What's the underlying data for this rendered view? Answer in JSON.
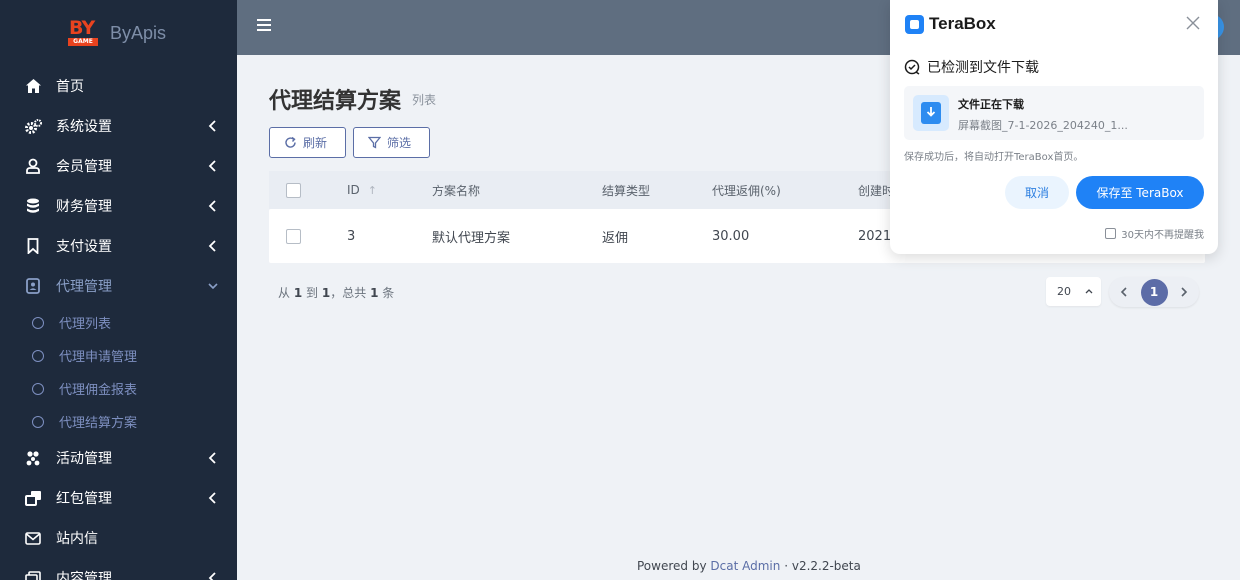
{
  "brand": {
    "logo_text": "BY",
    "logo_sub": "GAME",
    "name": "ByApis"
  },
  "sidebar": {
    "items": [
      {
        "label": "首页",
        "icon": "home-icon"
      },
      {
        "label": "系统设置",
        "icon": "cogs-icon"
      },
      {
        "label": "会员管理",
        "icon": "user-icon"
      },
      {
        "label": "财务管理",
        "icon": "database-icon"
      },
      {
        "label": "支付设置",
        "icon": "bookmark-icon"
      },
      {
        "label": "代理管理",
        "icon": "contact-icon"
      },
      {
        "label": "活动管理",
        "icon": "pinwheel-icon"
      },
      {
        "label": "红包管理",
        "icon": "clone-icon"
      },
      {
        "label": "站内信",
        "icon": "envelope-icon"
      },
      {
        "label": "内容管理",
        "icon": "window-icon"
      }
    ],
    "sub_items": [
      {
        "label": "代理列表"
      },
      {
        "label": "代理申请管理"
      },
      {
        "label": "代理佣金报表"
      },
      {
        "label": "代理结算方案"
      }
    ]
  },
  "page": {
    "title": "代理结算方案",
    "subtitle": "列表"
  },
  "toolbar": {
    "refresh_label": "刷新",
    "filter_label": "筛选"
  },
  "table": {
    "headers": [
      "ID",
      "方案名称",
      "结算类型",
      "代理返佣(%)",
      "创建时"
    ],
    "rows": [
      {
        "id": "3",
        "name": "默认代理方案",
        "type": "返佣",
        "rate": "30.00",
        "created": "2021"
      }
    ]
  },
  "summary": {
    "prefix": "从",
    "from": "1",
    "to_word": "到",
    "to": "1",
    "sep": "，总共",
    "total": "1",
    "suffix": "条"
  },
  "pagination": {
    "per_page": "20",
    "current": "1"
  },
  "footer": {
    "powered_by": "Powered by",
    "link": "Dcat Admin",
    "dot": "·",
    "version": "v2.2.2-beta"
  },
  "terabox": {
    "logo": "TeraBox",
    "detected": "已检测到文件下载",
    "file_title": "文件正在下载",
    "file_name": "屏幕截图_7-1-2026_204240_1...",
    "hint": "保存成功后，将自动打开TeraBox首页。",
    "cancel_label": "取消",
    "save_label": "保存至 TeraBox",
    "remind_label": "30天内不再提醒我"
  },
  "colors": {
    "sidebar": "#1e2a3c",
    "topbar": "#5f6e80",
    "accent": "#5b6ea6",
    "terabox_blue": "#1f82f6"
  }
}
